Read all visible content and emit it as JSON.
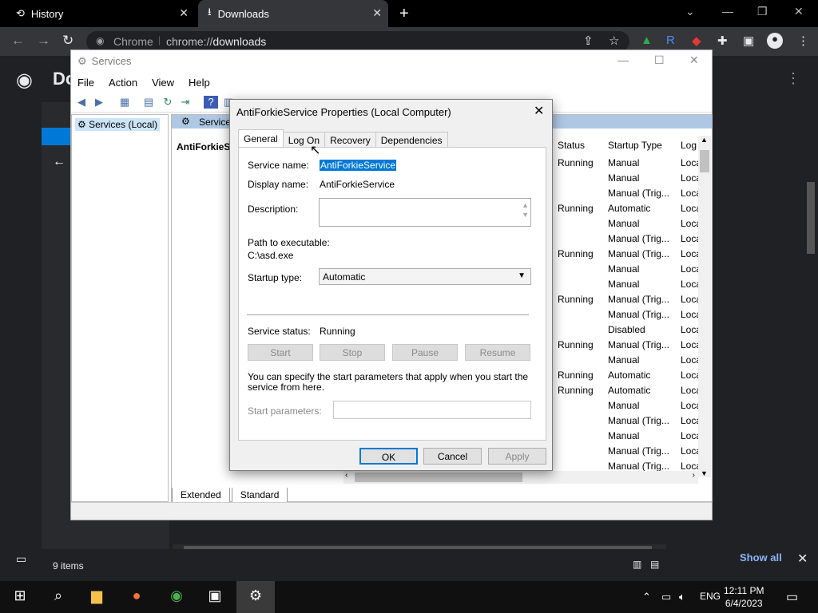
{
  "browser": {
    "tabs": [
      {
        "label": "History"
      },
      {
        "label": "Downloads"
      }
    ],
    "omnibox": {
      "chip": "Chrome",
      "url_scheme": "chrome://",
      "url_host": "downloads"
    },
    "page_title": "Do"
  },
  "services_window": {
    "title": "Services",
    "menu": [
      "File",
      "Action",
      "View",
      "Help"
    ],
    "tree_root": "Services (Local)",
    "list_header": "Service",
    "selected_service": "AntiForkieSe",
    "bottom_tabs": [
      "Extended",
      "Standard"
    ],
    "columns": {
      "status": "Status",
      "startup": "Startup Type",
      "logon": "Log"
    },
    "rows": [
      {
        "status": "Running",
        "startup": "Manual",
        "logon": "Loca"
      },
      {
        "status": "",
        "startup": "Manual",
        "logon": "Loca"
      },
      {
        "status": "",
        "startup": "Manual (Trig...",
        "logon": "Loca"
      },
      {
        "status": "Running",
        "startup": "Automatic",
        "logon": "Loca"
      },
      {
        "status": "",
        "startup": "Manual",
        "logon": "Loca"
      },
      {
        "status": "",
        "startup": "Manual (Trig...",
        "logon": "Loca"
      },
      {
        "status": "Running",
        "startup": "Manual (Trig...",
        "logon": "Loca"
      },
      {
        "status": "",
        "startup": "Manual",
        "logon": "Loca"
      },
      {
        "status": "",
        "startup": "Manual",
        "logon": "Loca"
      },
      {
        "status": "Running",
        "startup": "Manual (Trig...",
        "logon": "Loca"
      },
      {
        "status": "",
        "startup": "Manual (Trig...",
        "logon": "Loca"
      },
      {
        "status": "",
        "startup": "Disabled",
        "logon": "Loca"
      },
      {
        "status": "Running",
        "startup": "Manual (Trig...",
        "logon": "Loca"
      },
      {
        "status": "",
        "startup": "Manual",
        "logon": "Loca"
      },
      {
        "status": "Running",
        "startup": "Automatic",
        "logon": "Loca"
      },
      {
        "status": "Running",
        "startup": "Automatic",
        "logon": "Loca"
      },
      {
        "status": "",
        "startup": "Manual",
        "logon": "Loca"
      },
      {
        "status": "",
        "startup": "Manual (Trig...",
        "logon": "Loca"
      },
      {
        "status": "",
        "startup": "Manual",
        "logon": "Loca"
      },
      {
        "status": "",
        "startup": "Manual (Trig...",
        "logon": "Loca"
      },
      {
        "status": "",
        "startup": "Manual (Trig...",
        "logon": "Loca"
      }
    ]
  },
  "dialog": {
    "title": "AntiForkieService Properties (Local Computer)",
    "tabs": [
      "General",
      "Log On",
      "Recovery",
      "Dependencies"
    ],
    "service_name_label": "Service name:",
    "service_name": "AntiForkieService",
    "display_name_label": "Display name:",
    "display_name": "AntiForkieService",
    "description_label": "Description:",
    "path_label": "Path to executable:",
    "path": "C:\\asd.exe",
    "startup_type_label": "Startup type:",
    "startup_type": "Automatic",
    "status_label": "Service status:",
    "status": "Running",
    "buttons": {
      "start": "Start",
      "stop": "Stop",
      "pause": "Pause",
      "resume": "Resume"
    },
    "hint": "You can specify the start parameters that apply when you start the service from here.",
    "start_params_label": "Start parameters:",
    "ok": "OK",
    "cancel": "Cancel",
    "apply": "Apply"
  },
  "downloads": {
    "items_count": "9 items",
    "show_all": "Show all"
  },
  "taskbar": {
    "lang": "ENG",
    "time": "12:11 PM",
    "date": "6/4/2023"
  }
}
